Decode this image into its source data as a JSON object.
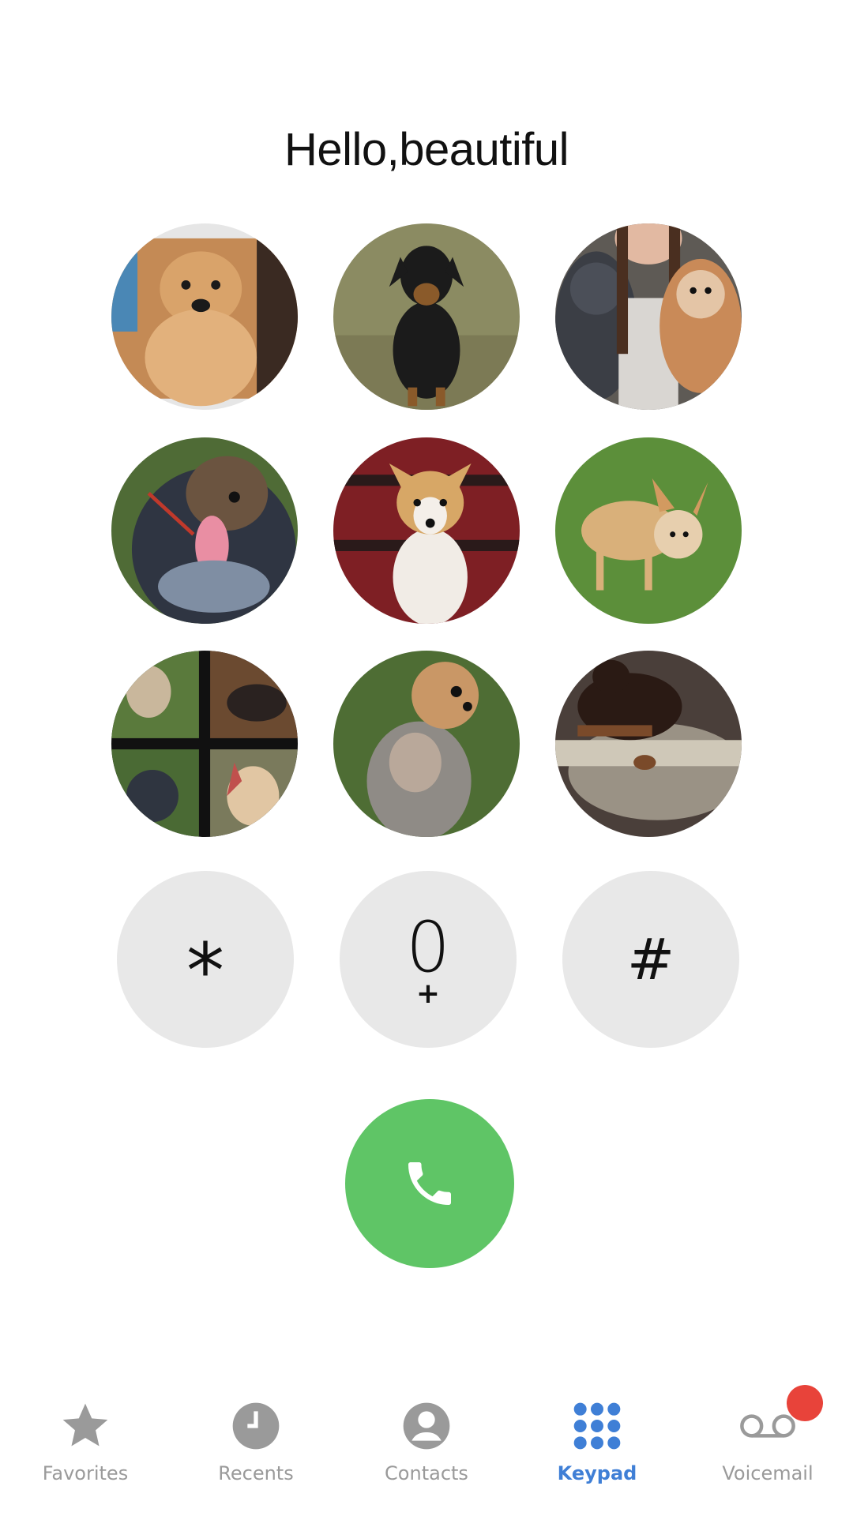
{
  "greeting": "Hello,beautiful",
  "keypad": {
    "star": "*",
    "zero": "0",
    "zero_sub": "+",
    "hash": "#"
  },
  "speed_dial_photos": [
    {
      "subject": "tan puppy"
    },
    {
      "subject": "black and tan dog on grass"
    },
    {
      "subject": "woman with two dogs"
    },
    {
      "subject": "blue heeler with tongue out"
    },
    {
      "subject": "small dog on red blanket"
    },
    {
      "subject": "red heeler on grass"
    },
    {
      "subject": "four-photo collage of dogs"
    },
    {
      "subject": "heeler sitting on grass"
    },
    {
      "subject": "dark dog on cushion"
    }
  ],
  "tabs": [
    {
      "label": "Favorites",
      "icon": "star-icon"
    },
    {
      "label": "Recents",
      "icon": "clock-icon"
    },
    {
      "label": "Contacts",
      "icon": "person-icon"
    },
    {
      "label": "Keypad",
      "icon": "keypad-icon"
    },
    {
      "label": "Voicemail",
      "icon": "voicemail-icon"
    }
  ],
  "active_tab": "Keypad",
  "colors": {
    "call_button": "#5fc566",
    "active_tab": "#3f7fd6",
    "inactive_tab": "#9a9a9a",
    "key_background": "#e8e8e8",
    "badge": "#e8433a"
  }
}
